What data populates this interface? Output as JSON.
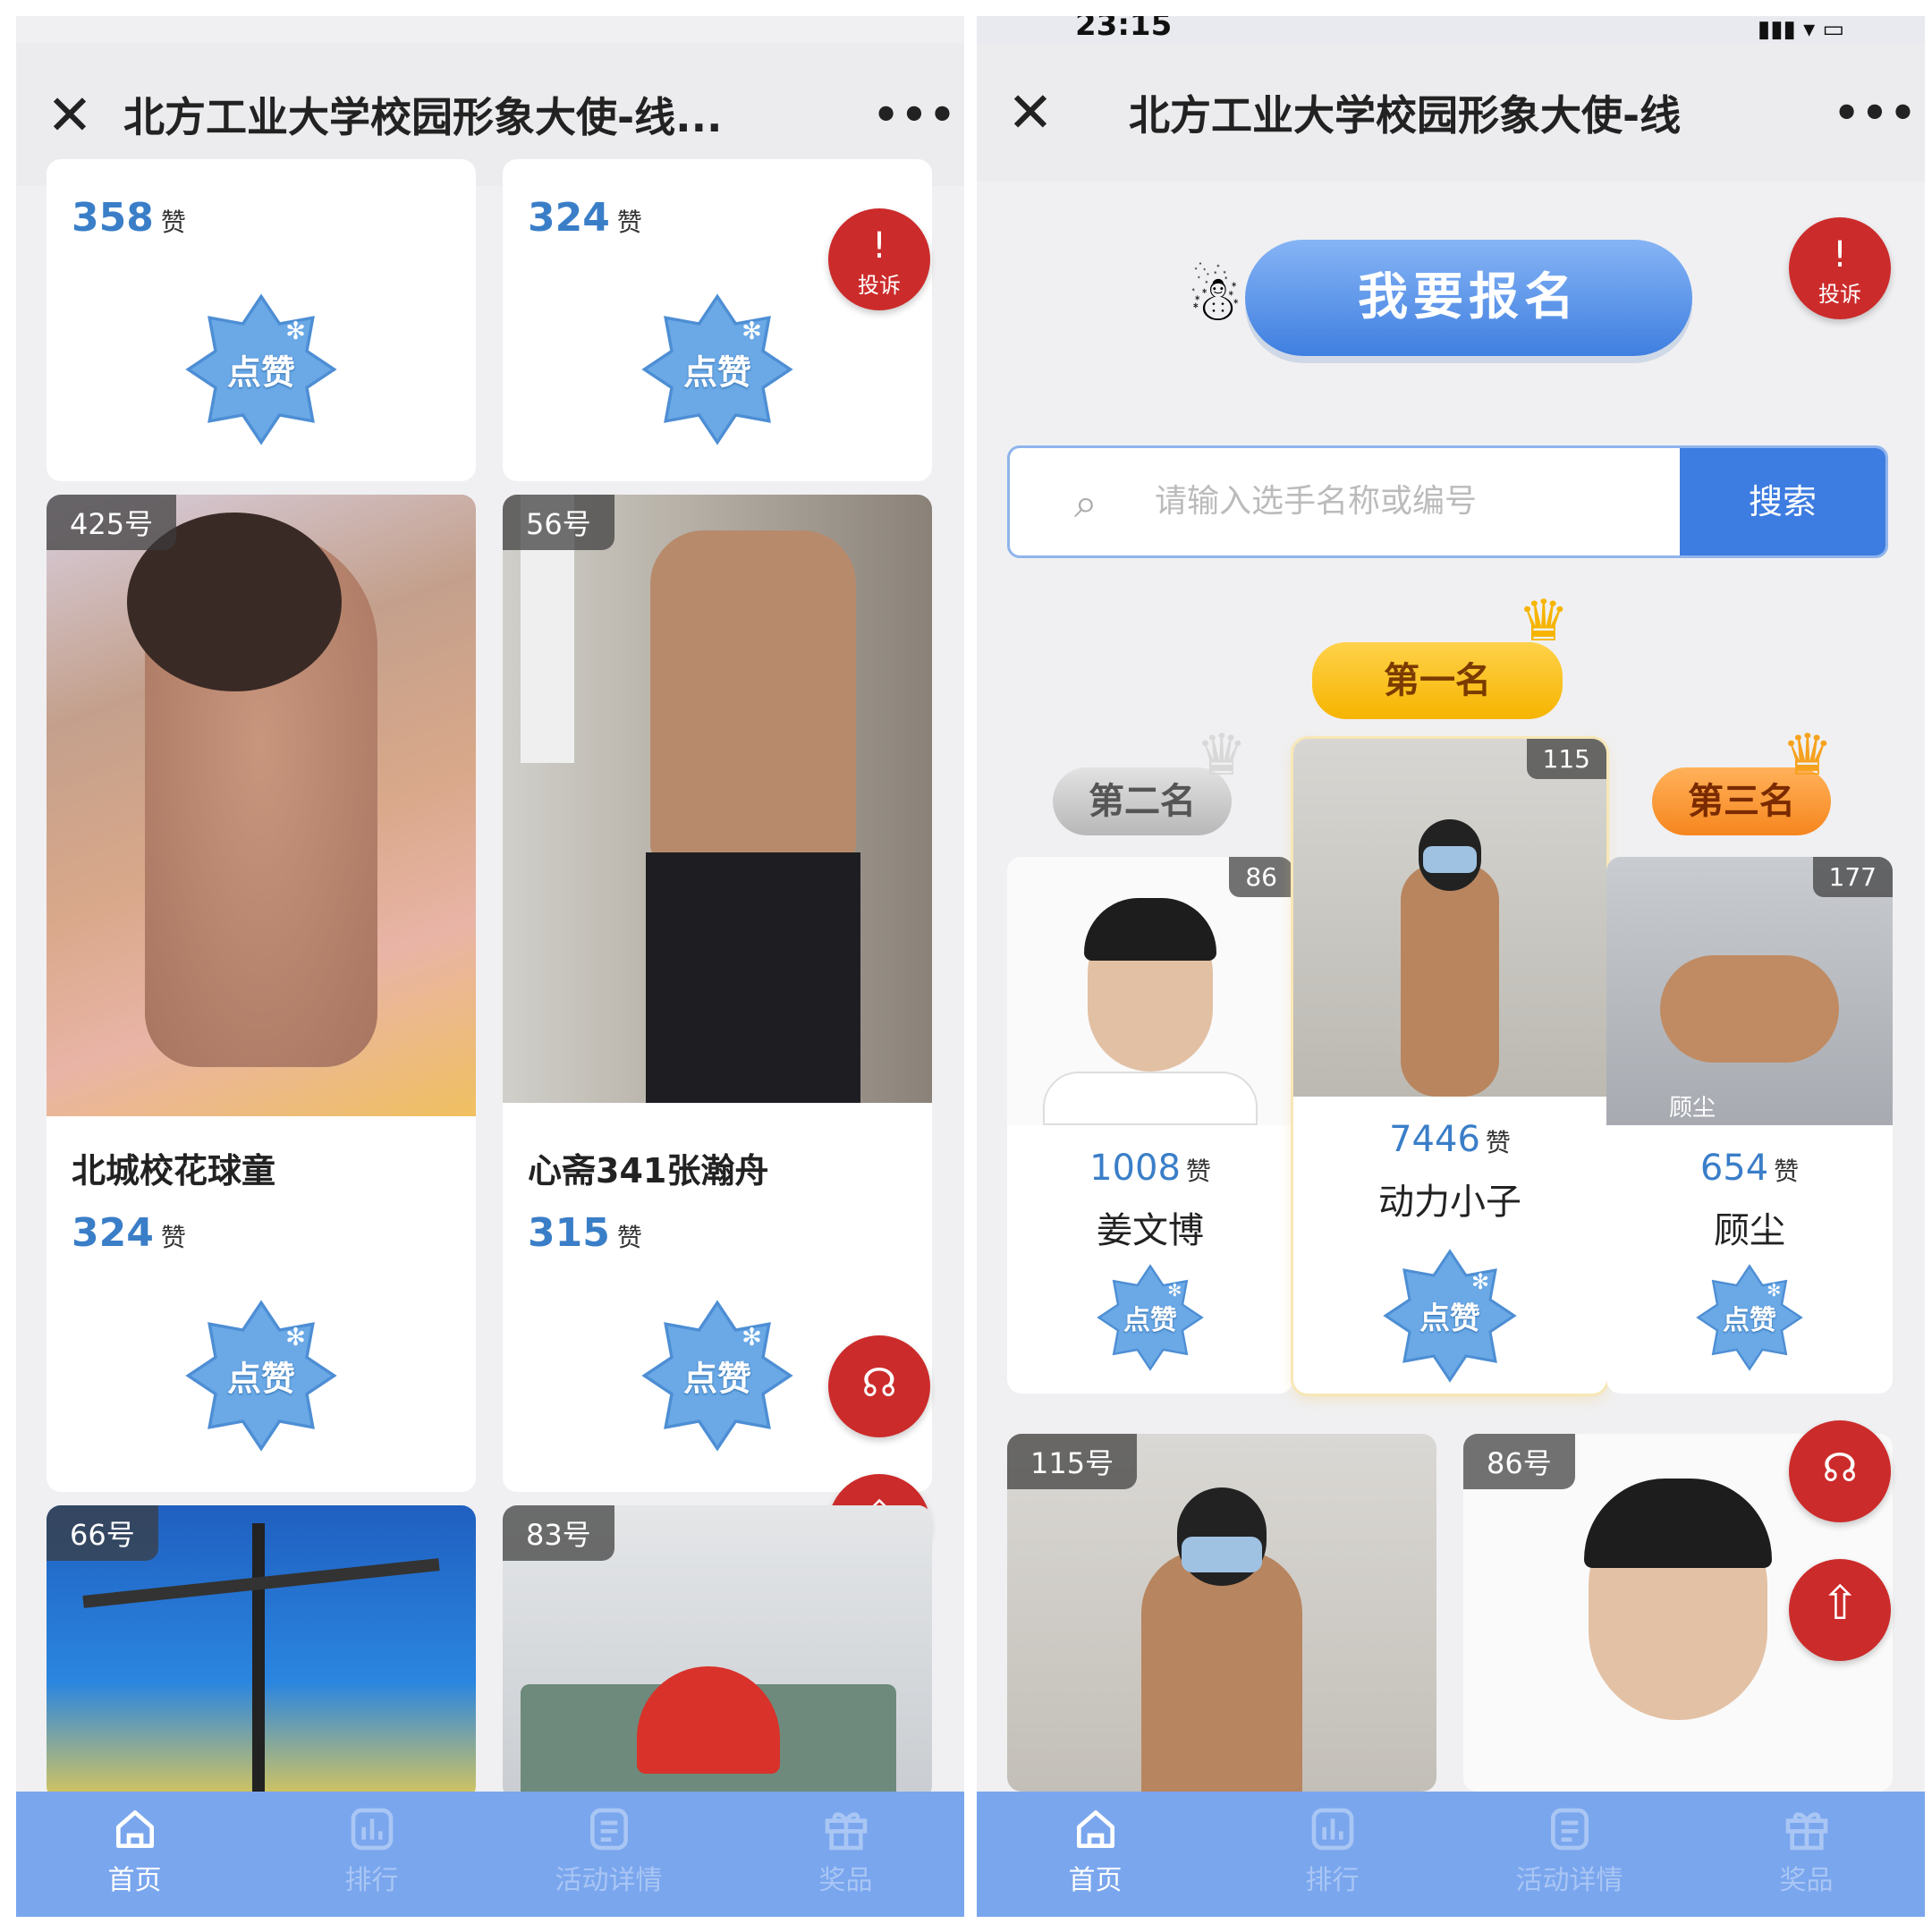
{
  "left": {
    "nav": {
      "title": "北方工业大学校园形象大使-线...",
      "close": "✕",
      "more": "•••"
    },
    "top_cards": [
      {
        "likes": "358",
        "unit": "赞",
        "button": "点赞"
      },
      {
        "likes": "324",
        "unit": "赞",
        "button": "点赞"
      }
    ],
    "mid_cards": [
      {
        "number": "425号",
        "name": "北城校花球童",
        "likes": "324",
        "unit": "赞",
        "button": "点赞"
      },
      {
        "number": "56号",
        "name": "心斋341张瀚舟",
        "likes": "315",
        "unit": "赞",
        "button": "点赞"
      }
    ],
    "bottom_cards": [
      {
        "number": "66号"
      },
      {
        "number": "83号"
      }
    ],
    "complaint": {
      "icon": "!",
      "label": "投诉"
    }
  },
  "right": {
    "status": {
      "time": "23:15",
      "signal": "▮▮▮ ▾ ▭"
    },
    "nav": {
      "title": "北方工业大学校园形象大使-线",
      "close": "✕",
      "more": "•••"
    },
    "signup_label": "我要报名",
    "search": {
      "placeholder": "请输入选手名称或编号",
      "button": "搜索"
    },
    "ranks": {
      "first": "第一名",
      "second": "第二名",
      "third": "第三名"
    },
    "podium": [
      {
        "tag": "86",
        "likes": "1008",
        "unit": "赞",
        "name": "姜文博",
        "button": "点赞"
      },
      {
        "tag": "115",
        "likes": "7446",
        "unit": "赞",
        "name": "动力小子",
        "button": "点赞"
      },
      {
        "tag": "177",
        "likes": "654",
        "unit": "赞",
        "name": "顾尘",
        "button": "点赞",
        "photo_caption": "顾尘"
      }
    ],
    "bottom_cards": [
      {
        "number": "115号"
      },
      {
        "number": "86号"
      }
    ],
    "complaint": {
      "icon": "!",
      "label": "投诉"
    }
  },
  "tabs": [
    {
      "label": "首页",
      "icon": "home-icon"
    },
    {
      "label": "排行",
      "icon": "chart-icon"
    },
    {
      "label": "活动详情",
      "icon": "document-icon"
    },
    {
      "label": "奖品",
      "icon": "gift-icon"
    }
  ],
  "colors": {
    "accent": "#3d7ce0",
    "tabbar": "#7aa6ee",
    "red": "#cc2b2b",
    "likes": "#3a7ec8",
    "gold": "#f6b400"
  }
}
